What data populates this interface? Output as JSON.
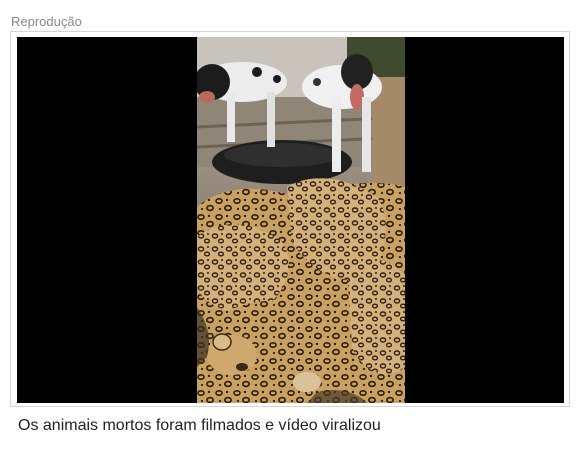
{
  "credit": "Reprodução",
  "image": {
    "alt": "Os animais mortos foram filmados e vídeo viralizou"
  },
  "caption": "Os animais mortos foram filmados e vídeo viralizou"
}
